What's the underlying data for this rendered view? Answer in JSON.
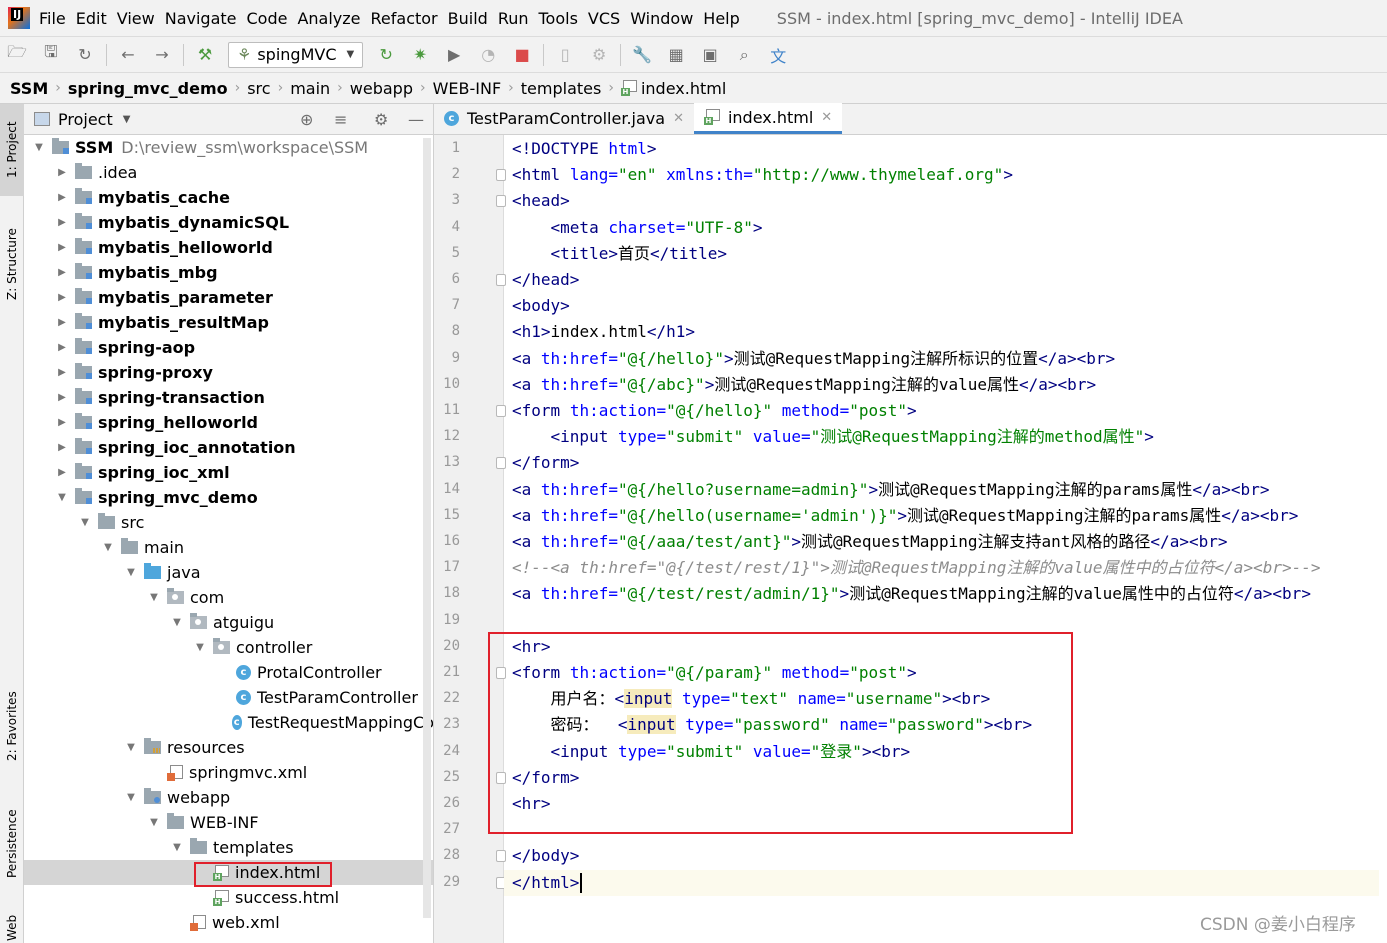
{
  "menu": {
    "items": [
      "File",
      "Edit",
      "View",
      "Navigate",
      "Code",
      "Analyze",
      "Refactor",
      "Build",
      "Run",
      "Tools",
      "VCS",
      "Window",
      "Help"
    ],
    "window_title": "SSM - index.html [spring_mvc_demo] - IntelliJ IDEA"
  },
  "toolbar": {
    "run_config": "spingMVC"
  },
  "breadcrumb": [
    "SSM",
    "spring_mvc_demo",
    "src",
    "main",
    "webapp",
    "WEB-INF",
    "templates",
    "index.html"
  ],
  "left_strip": {
    "project": "1: Project",
    "structure": "Z: Structure",
    "favorites": "2: Favorites",
    "persistence": "Persistence",
    "web": "Web"
  },
  "project_panel": {
    "title": "Project",
    "tree": [
      {
        "label": "SSM",
        "path": "D:\\review_ssm\\workspace\\SSM",
        "depth": 0,
        "expanded": true,
        "kind": "module",
        "bold": true
      },
      {
        "label": ".idea",
        "depth": 1,
        "expanded": false,
        "kind": "folder",
        "bold": false
      },
      {
        "label": "mybatis_cache",
        "depth": 1,
        "expanded": false,
        "kind": "module",
        "bold": true
      },
      {
        "label": "mybatis_dynamicSQL",
        "depth": 1,
        "expanded": false,
        "kind": "module",
        "bold": true
      },
      {
        "label": "mybatis_helloworld",
        "depth": 1,
        "expanded": false,
        "kind": "module",
        "bold": true
      },
      {
        "label": "mybatis_mbg",
        "depth": 1,
        "expanded": false,
        "kind": "module",
        "bold": true
      },
      {
        "label": "mybatis_parameter",
        "depth": 1,
        "expanded": false,
        "kind": "module",
        "bold": true
      },
      {
        "label": "mybatis_resultMap",
        "depth": 1,
        "expanded": false,
        "kind": "module",
        "bold": true
      },
      {
        "label": "spring-aop",
        "depth": 1,
        "expanded": false,
        "kind": "module",
        "bold": true
      },
      {
        "label": "spring-proxy",
        "depth": 1,
        "expanded": false,
        "kind": "module",
        "bold": true
      },
      {
        "label": "spring-transaction",
        "depth": 1,
        "expanded": false,
        "kind": "module",
        "bold": true
      },
      {
        "label": "spring_helloworld",
        "depth": 1,
        "expanded": false,
        "kind": "module",
        "bold": true
      },
      {
        "label": "spring_ioc_annotation",
        "depth": 1,
        "expanded": false,
        "kind": "module",
        "bold": true
      },
      {
        "label": "spring_ioc_xml",
        "depth": 1,
        "expanded": false,
        "kind": "module",
        "bold": true
      },
      {
        "label": "spring_mvc_demo",
        "depth": 1,
        "expanded": true,
        "kind": "module",
        "bold": true
      },
      {
        "label": "src",
        "depth": 2,
        "expanded": true,
        "kind": "folder",
        "bold": false
      },
      {
        "label": "main",
        "depth": 3,
        "expanded": true,
        "kind": "folder",
        "bold": false
      },
      {
        "label": "java",
        "depth": 4,
        "expanded": true,
        "kind": "src",
        "bold": false
      },
      {
        "label": "com",
        "depth": 5,
        "expanded": true,
        "kind": "pkg",
        "bold": false
      },
      {
        "label": "atguigu",
        "depth": 6,
        "expanded": true,
        "kind": "pkg",
        "bold": false
      },
      {
        "label": "controller",
        "depth": 7,
        "expanded": true,
        "kind": "pkg",
        "bold": false
      },
      {
        "label": "ProtalController",
        "depth": 8,
        "kind": "class",
        "bold": false
      },
      {
        "label": "TestParamController",
        "depth": 8,
        "kind": "class",
        "bold": false
      },
      {
        "label": "TestRequestMappingCo",
        "depth": 8,
        "kind": "class",
        "bold": false
      },
      {
        "label": "resources",
        "depth": 4,
        "expanded": true,
        "kind": "res",
        "bold": false
      },
      {
        "label": "springmvc.xml",
        "depth": 5,
        "kind": "xml",
        "bold": false
      },
      {
        "label": "webapp",
        "depth": 4,
        "expanded": true,
        "kind": "web",
        "bold": false
      },
      {
        "label": "WEB-INF",
        "depth": 5,
        "expanded": true,
        "kind": "folder",
        "bold": false
      },
      {
        "label": "templates",
        "depth": 6,
        "expanded": true,
        "kind": "folder",
        "bold": false
      },
      {
        "label": "index.html",
        "depth": 7,
        "kind": "html",
        "bold": false,
        "selected": true
      },
      {
        "label": "success.html",
        "depth": 7,
        "kind": "html",
        "bold": false
      },
      {
        "label": "web.xml",
        "depth": 6,
        "kind": "xml",
        "bold": false
      }
    ]
  },
  "editor": {
    "tabs": [
      {
        "label": "TestParamController.java",
        "active": false
      },
      {
        "label": "index.html",
        "active": true
      }
    ],
    "lines": [
      "<!DOCTYPE html>",
      "<html lang=\"en\" xmlns:th=\"http://www.thymeleaf.org\">",
      "<head>",
      "    <meta charset=\"UTF-8\">",
      "    <title>首页</title>",
      "</head>",
      "<body>",
      "<h1>index.html</h1>",
      "<a th:href=\"@{/hello}\">测试@RequestMapping注解所标识的位置</a><br>",
      "<a th:href=\"@{/abc}\">测试@RequestMapping注解的value属性</a><br>",
      "<form th:action=\"@{/hello}\" method=\"post\">",
      "    <input type=\"submit\" value=\"测试@RequestMapping注解的method属性\">",
      "</form>",
      "<a th:href=\"@{/hello?username=admin}\">测试@RequestMapping注解的params属性</a><br>",
      "<a th:href=\"@{/hello(username='admin')}\">测试@RequestMapping注解的params属性</a><br>",
      "<a th:href=\"@{/aaa/test/ant}\">测试@RequestMapping注解支持ant风格的路径</a><br>",
      "<!--<a th:href=\"@{/test/rest/1}\">测试@RequestMapping注解的value属性中的占位符</a><br>-->",
      "<a th:href=\"@{/test/rest/admin/1}\">测试@RequestMapping注解的value属性中的占位符</a><br>",
      "",
      "<hr>",
      "<form th:action=\"@{/param}\" method=\"post\">",
      "    用户名：<input type=\"text\" name=\"username\"><br>",
      "    密码：  <input type=\"password\" name=\"password\"><br>",
      "    <input type=\"submit\" value=\"登录\"><br>",
      "</form>",
      "<hr>",
      "",
      "</body>",
      "</html>"
    ]
  },
  "watermark": "CSDN @姜小白程序"
}
